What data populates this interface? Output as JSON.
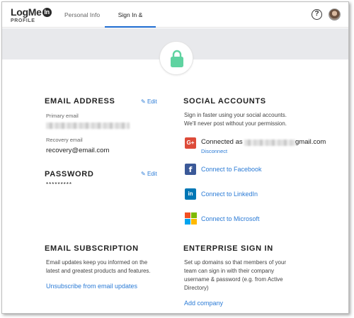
{
  "header": {
    "logo_main": "LogMe",
    "logo_badge": "In",
    "logo_sub": "PROFILE",
    "tabs": [
      "Personal Info",
      "Sign In & Security"
    ],
    "active_tab": "Sign In & Security",
    "help_icon": "help-circle-icon",
    "avatar_icon": "user-avatar"
  },
  "banner": {
    "icon": "lock-icon",
    "icon_color": "#5fd3a1"
  },
  "email": {
    "title": "EMAIL ADDRESS",
    "edit": "Edit",
    "primary_label": "Primary email",
    "recovery_label": "Recovery email",
    "recovery_value": "recovery@email.com"
  },
  "password": {
    "title": "PASSWORD",
    "edit": "Edit",
    "masked": "*********"
  },
  "subscription": {
    "title": "EMAIL SUBSCRIPTION",
    "desc_line1": "Email updates keep you informed on the",
    "desc_line2": "latest and greatest products and features.",
    "link": "Unsubscribe from email updates"
  },
  "social": {
    "title": "SOCIAL ACCOUNTS",
    "desc_line1": "Sign in faster using your social accounts.",
    "desc_line2": "We'll never post without your permission.",
    "google": {
      "icon_label": "G+",
      "connected_prefix": "Connected as",
      "connected_suffix": "gmail.com",
      "disconnect": "Disconnect",
      "color": "#dd4b39"
    },
    "facebook": {
      "icon_label": "f",
      "link": "Connect to Facebook",
      "color": "#3b5998"
    },
    "linkedin": {
      "icon_label": "in",
      "link": "Connect to LinkedIn",
      "color": "#0077b5"
    },
    "microsoft": {
      "link": "Connect to Microsoft",
      "colors": [
        "#f25022",
        "#7fba00",
        "#00a4ef",
        "#ffb900"
      ]
    }
  },
  "enterprise": {
    "title": "ENTERPRISE SIGN IN",
    "desc_line1": "Set up domains so that members of your",
    "desc_line2": "team can sign in with their company",
    "desc_line3": "username & password (e.g. from Active",
    "desc_line4": "Directory)",
    "link": "Add company"
  },
  "accent_color": "#2b7bd6"
}
